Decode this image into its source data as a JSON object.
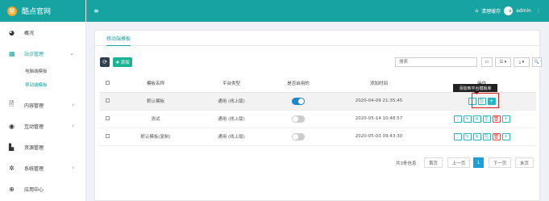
{
  "app": {
    "title": "酷点官网",
    "logo_char": "酷"
  },
  "topbar": {
    "menu_icon": "bars-icon",
    "clear_cache": "清理缓存",
    "user": "admin",
    "more": "⋮",
    "avatar_char": "a"
  },
  "sidebar": {
    "items": [
      {
        "label": "概况",
        "icon": "dashboard-icon"
      },
      {
        "label": "站点管理",
        "icon": "grid-icon",
        "expanded": true,
        "children": [
          "电脑端模板",
          "移动端模板"
        ]
      },
      {
        "label": "内容管理",
        "icon": "file-icon"
      },
      {
        "label": "互动管理",
        "icon": "eye-icon"
      },
      {
        "label": "资源管理",
        "icon": "document-icon"
      },
      {
        "label": "系统管理",
        "icon": "gear-icon"
      },
      {
        "label": "应用中心",
        "icon": "globe-icon"
      }
    ]
  },
  "tabs": [
    "移动端模板"
  ],
  "toolbar": {
    "add": "✚ 添加",
    "search_placeholder": "搜索",
    "btn1": "▭",
    "btn2": "☷ ▾",
    "btn3": "⤓ ▾",
    "btn4": "🔍"
  },
  "table": {
    "headers": [
      "",
      "模板名称",
      "平台类型",
      "是否启用的",
      "添加时间",
      "操作"
    ],
    "rows": [
      {
        "name": "默认模板",
        "platform": "通用 (线上版)",
        "enabled": true,
        "time": "2020-04-09 21:35:45"
      },
      {
        "name": "测试",
        "platform": "通用 (线上版)",
        "enabled": false,
        "time": "2020-05-14 10:48:57"
      },
      {
        "name": "默认模板(复制)",
        "platform": "通用 (线上版)",
        "enabled": false,
        "time": "2020-05-03 09:43:30"
      }
    ]
  },
  "tooltip": "添加到平台模板库",
  "pager": {
    "info": "共3条信息",
    "first": "首页",
    "prev": "上一页",
    "current": "1",
    "next": "下一页",
    "last": "末页"
  },
  "colors": {
    "accent": "#16a3a1",
    "topbar": "#16a3a1",
    "toggle_on": "#1e87c8",
    "danger": "#e64a4a",
    "action": "#23b7c3",
    "pager_active": "#1e9fd9"
  }
}
